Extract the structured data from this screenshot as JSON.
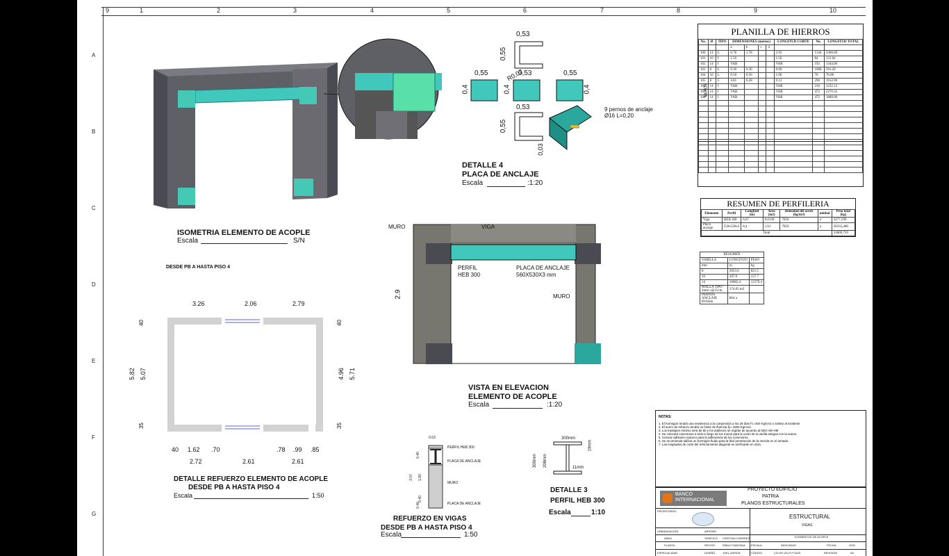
{
  "grid": {
    "columns": [
      "9",
      "1",
      "2",
      "3",
      "4",
      "5",
      "6",
      "7",
      "8",
      "9",
      "10"
    ],
    "rows": [
      "A",
      "B",
      "C",
      "D",
      "E",
      "F",
      "G"
    ]
  },
  "isometric": {
    "title": "ISOMETRIA ELEMENTO DE ACOPLE",
    "scale_label": "Escala",
    "scale_value": "S/N"
  },
  "detail4": {
    "title_line1": "DETALLE 4",
    "title_line2": "PLACA DE ANCLAJE",
    "scale_label": "Escala",
    "scale_value": ":1:20",
    "dims": [
      "0,53",
      "0,55",
      "R0,02",
      "0,53",
      "0,55",
      "0,55",
      "0,4",
      "0,4",
      "0,4",
      "0,53",
      "0,55",
      "0,03"
    ],
    "bolt_note_line1": "9 pernos de anclaje",
    "bolt_note_line2": "Ø16  L=0,20"
  },
  "planilla": {
    "title": "PLANILLA DE HIERROS",
    "headers": [
      "No.",
      "Ø",
      "TIPO",
      "DIMENSIONES (metros)",
      "LONGITUD CORTE",
      "No.",
      "LONGITUD TOTAL"
    ],
    "subheaders": [
      "a",
      "b",
      "c",
      "d"
    ],
    "side_label": "MUROS",
    "rows": [
      [
        "100",
        "14",
        "L",
        "0.78",
        "1.78",
        "",
        "",
        "2.92",
        "1344",
        "3360.00"
      ],
      [
        "101",
        "10",
        "I",
        "1.56",
        "",
        "",
        "",
        "1.56",
        "84",
        "131.04"
      ],
      [
        "102",
        "14",
        "I",
        "VAR",
        "",
        "",
        "",
        "VAR",
        "192",
        "1344.00"
      ],
      [
        "103",
        "8",
        "L",
        "0.30",
        "0.30",
        "",
        "",
        "0.60",
        "1008",
        "501.20"
      ],
      [
        "104",
        "10",
        "L",
        "0.50",
        "0.50",
        "",
        "",
        "1.00",
        "76",
        "76.00"
      ],
      [
        "105",
        "8",
        "C",
        "4.81",
        "0.28",
        "",
        "",
        "9.12",
        "296",
        "1912.96"
      ],
      [
        "106",
        "14",
        "I",
        "VAR",
        "",
        "",
        "",
        "VAR",
        "216",
        "1232.12"
      ],
      [
        "107",
        "14",
        "I",
        "VAR",
        "",
        "",
        "",
        "VAR",
        "472",
        "2270.32"
      ],
      [
        "108",
        "14",
        "I",
        "VAR",
        "",
        "",
        "",
        "VAR",
        "472",
        "1888.00"
      ]
    ]
  },
  "perfileria": {
    "title": "RESUMEN DE PERFILERIA",
    "headers": [
      "Elemento",
      "Perfil",
      "Longitud (m)",
      "Area (m2)",
      "Densidad del acero (kg/m3)",
      "unidad",
      "Peso total (kg)"
    ],
    "rows": [
      [
        "Viga",
        "HEB 300",
        "6,67",
        "0,0149",
        "7850",
        "u",
        "3277,599"
      ],
      [
        "Placa anclaje",
        "550x530x3",
        "8,4",
        "1,61",
        "7850",
        "u",
        "30332,400"
      ]
    ],
    "total_label": "Total",
    "total_value": "33609,759"
  },
  "resumen": {
    "title": "RESUMEN",
    "headers": [
      "VARILLA",
      "LONGITUD",
      "PESO"
    ],
    "units": [
      "mm",
      "m",
      "kg"
    ],
    "rows": [
      [
        "8",
        "2053.6",
        "821.5"
      ],
      [
        "10",
        "207.0",
        "127.7"
      ],
      [
        "14",
        "10082.4",
        "12179.4"
      ],
      [
        "MALLA TIPO 4mm c@15cm",
        "374.05 m2",
        ""
      ],
      [
        "PERNOS ANCLAJE Ø16mm",
        "864 u",
        ""
      ]
    ]
  },
  "elevation": {
    "title_line1": "VISTA EN ELEVACION",
    "title_line2": "ELEMENTO DE ACOPLE",
    "scale_label": "Escala",
    "scale_value": ":1:20",
    "label_muro_left": "MURO",
    "label_viga": "VIGA",
    "label_muro_right": "MURO",
    "label_perfil": "PERFIL",
    "label_heb": "HEB 300",
    "label_placa_line1": "PLACA DE ANCLAJE",
    "label_placa_line2": "560X530X3  mm",
    "height_dim": "2.9"
  },
  "plan": {
    "caption": "DESDE PB A HASTA PISO 4",
    "top_dims": [
      "3.26",
      "2.06",
      "2.79"
    ],
    "left_dims": [
      "40",
      "5.82",
      "5.07",
      "35"
    ],
    "right_dims": [
      "40",
      "4.96",
      "5.71",
      "35"
    ],
    "bottom_dims_1": [
      "40",
      "1.62",
      ".70",
      ".78",
      ".99",
      ".85"
    ],
    "bottom_dims_2": [
      "2.72",
      "2.61",
      "2.61"
    ],
    "title_line1": "DETALLE REFUERZO  ELEMENTO DE ACOPLE",
    "title_line2": "DESDE PB A HASTA PISO 4",
    "scale_label": "Escala",
    "scale_value": "1:50"
  },
  "refuerzo": {
    "labels": [
      "PERFIL HEB 300",
      "PLACA DE ANCLAJE",
      "MURO",
      "PLACA DE ANCLAJE"
    ],
    "dims": [
      "0.53",
      "0.40",
      "3.07",
      "1.80",
      "0.40",
      "0.40"
    ],
    "title_line1": "REFUERZO EN VIGAS",
    "title_line2": "DESDE PB A HASTA PISO 4",
    "scale_label": "Escala",
    "scale_value": "1:50"
  },
  "detail3": {
    "dims": [
      "300mm",
      "19mm",
      "300mm",
      "208mm",
      "11mm"
    ],
    "title_line1": "DETALLE 3",
    "title_line2": "PERFIL HEB 300",
    "scale_label": "Escala",
    "scale_value": "1:10"
  },
  "notes": {
    "heading": "NOTAS:",
    "items": [
      "1.  El hormigón tendrá una resistencia a la compresión a los 28 días f'c=400 Kg/cm2 o similar al existente",
      "2.  El acero de refuerzo tendrá un límite de fluencia fy= 4200 Kg/cm2.",
      "3.  Los traslapes mínimo será de 60 y los dobleces se regirán de acuerdo al NEC-SE-HM",
      "4.  Se colocará conectores a todo lo largo de los muros para la unión de la varilla antigua con la nueva.",
      "5.  Colocar adhesivo epóxico para la adherencia de los conectores.",
      "6.  Se recomienda utilizar un hormigón fluido para la fácil penetración de la mezcla en el armado.",
      "7.  Las longitudes de corte del reforzamiento diagonal se verificarán en obra."
    ]
  },
  "title_block": {
    "bank_line1": "BANCO",
    "bank_line2": "INTERNACIONAL",
    "project_line1": "PROYECTO EDIFICIO",
    "project_line2": "PATRIA",
    "project_line3": "PLANOS ESTRUCTURALES",
    "propietario": "PROPIETARIO:",
    "discipline": "ESTRUCTURAL",
    "sheet_type": "VIGAS",
    "sheet_desc": "ELEMENTOS DE ACOPLE",
    "left_labels": [
      "URBANIZACIÓN",
      "ÁREA",
      "PLANTA",
      "ESPECIALIDAD"
    ],
    "role_labels": [
      "APROBÓ",
      "VERIFICÓ",
      "REVISÓ",
      "DISEÑÓ"
    ],
    "names": [
      "",
      "CRISTIAN CHERREZ",
      "PABLO SANTANA",
      "JOEL ZAPATA"
    ],
    "right_labels": [
      "ESCALA",
      "CÓDIGO"
    ],
    "right_values": [
      "INDICADAS",
      "CIV-EP-ZO-P-P-0020"
    ],
    "fecha_label": "FECHA",
    "fecha_value": "2020",
    "revision_label": "REVISIÓN",
    "revision_value": "A0"
  },
  "colors": {
    "concrete": "#5f5f66",
    "teal": "#3cc3b8",
    "plate": "#2aa89e"
  }
}
